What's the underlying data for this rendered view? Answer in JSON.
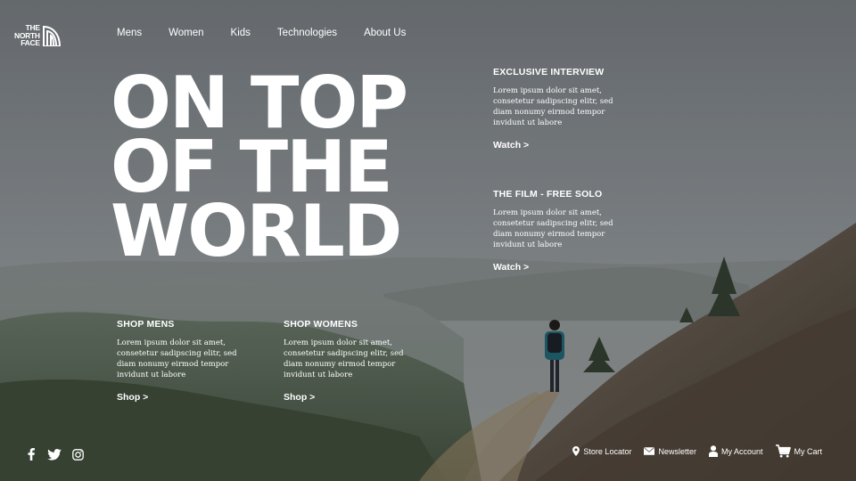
{
  "brand": {
    "logo_lines": [
      "THE",
      "NORTH",
      "FACE"
    ]
  },
  "nav": {
    "items": [
      "Mens",
      "Women",
      "Kids",
      "Technologies",
      "About Us"
    ]
  },
  "hero": {
    "headline_lines": [
      "ON TOP",
      "OF THE",
      "WORLD"
    ]
  },
  "features": [
    {
      "title": "EXCLUSIVE INTERVIEW",
      "body": "Lorem ipsum dolor sit amet, consetetur sadipscing elitr, sed diam nonumy eirmod tempor invidunt ut labore",
      "link": "Watch >"
    },
    {
      "title": "THE FILM - FREE SOLO",
      "body": "Lorem ipsum dolor sit amet, consetetur sadipscing elitr, sed diam nonumy eirmod tempor invidunt ut labore",
      "link": "Watch >"
    }
  ],
  "shop": [
    {
      "title": "SHOP MENS",
      "body": "Lorem ipsum dolor sit amet, consetetur sadipscing elitr, sed diam nonumy eirmod tempor invidunt ut labore",
      "link": "Shop >"
    },
    {
      "title": "SHOP WOMENS",
      "body": "Lorem ipsum dolor sit amet, consetetur sadipscing elitr, sed diam nonumy eirmod tempor invidunt ut labore",
      "link": "Shop >"
    }
  ],
  "social": {
    "icons": [
      "facebook-icon",
      "twitter-icon",
      "instagram-icon"
    ]
  },
  "utilities": [
    {
      "label": "Store Locator",
      "icon": "map-pin-icon"
    },
    {
      "label": "Newsletter",
      "icon": "envelope-icon"
    },
    {
      "label": "My Account",
      "icon": "user-icon"
    },
    {
      "label": "My Cart",
      "icon": "cart-icon"
    }
  ],
  "colors": {
    "sky": "#7b7f83",
    "text": "#ffffff",
    "hillside": "#5c5248",
    "valley": "#4c5a45"
  }
}
